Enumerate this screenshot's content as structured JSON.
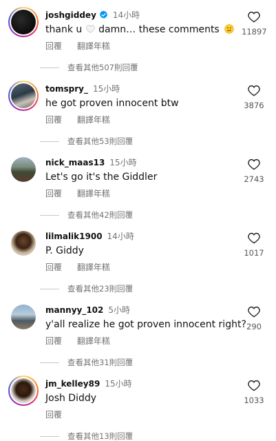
{
  "comments": [
    {
      "username": "joshgiddey",
      "verified": true,
      "time": "14小時",
      "text_parts": [
        "thank u",
        "damn… these comments"
      ],
      "text_emojis": [
        "white-heart-emoji",
        "confused-face-emoji"
      ],
      "reply_label": "回覆",
      "translate_label": "翻譯年糕",
      "likes": "11897",
      "view_replies": "查看其他507則回覆",
      "avatar": "dark-avatar"
    },
    {
      "username": "tomspry_",
      "time": "15小時",
      "text": "he got proven innocent btw",
      "reply_label": "回覆",
      "translate_label": "翻譯年糕",
      "likes": "3876",
      "view_replies": "查看其他53則回覆",
      "avatar": "group-photo-avatar"
    },
    {
      "username": "nick_maas13",
      "time": "15小時",
      "text": "Let's go it's the Giddler",
      "reply_label": "回覆",
      "translate_label": "翻譯年糕",
      "likes": "2743",
      "view_replies": "查看其他42則回覆",
      "avatar": "outdoor-photo-avatar"
    },
    {
      "username": "lilmalik1900",
      "time": "14小時",
      "text": "P. Giddy",
      "reply_label": "回覆",
      "translate_label": "翻譯年糕",
      "likes": "1017",
      "view_replies": "查看其他23則回覆",
      "avatar": "portrait-avatar"
    },
    {
      "username": "mannyy_102",
      "time": "5小時",
      "text": "y'all realize he got proven innocent right?",
      "reply_label": "回覆",
      "translate_label": "翻譯年糕",
      "likes": "290",
      "view_replies": "查看其他31則回覆",
      "avatar": "beach-photo-avatar"
    },
    {
      "username": "jm_kelley89",
      "time": "15小時",
      "text": "Josh Diddy",
      "reply_label": "回覆",
      "likes": "1033",
      "view_replies": "查看其他13則回覆",
      "avatar": "portrait-avatar-2"
    }
  ],
  "colors": {
    "story_ring": [
      "#feda75",
      "#fa7e1e",
      "#d62976",
      "#962fbf",
      "#4f5bd5"
    ],
    "verified_badge": "#0095f6",
    "secondary_text": "#737373"
  },
  "icons": {
    "like": "heart-outline-icon",
    "verified": "verified-badge-icon"
  }
}
